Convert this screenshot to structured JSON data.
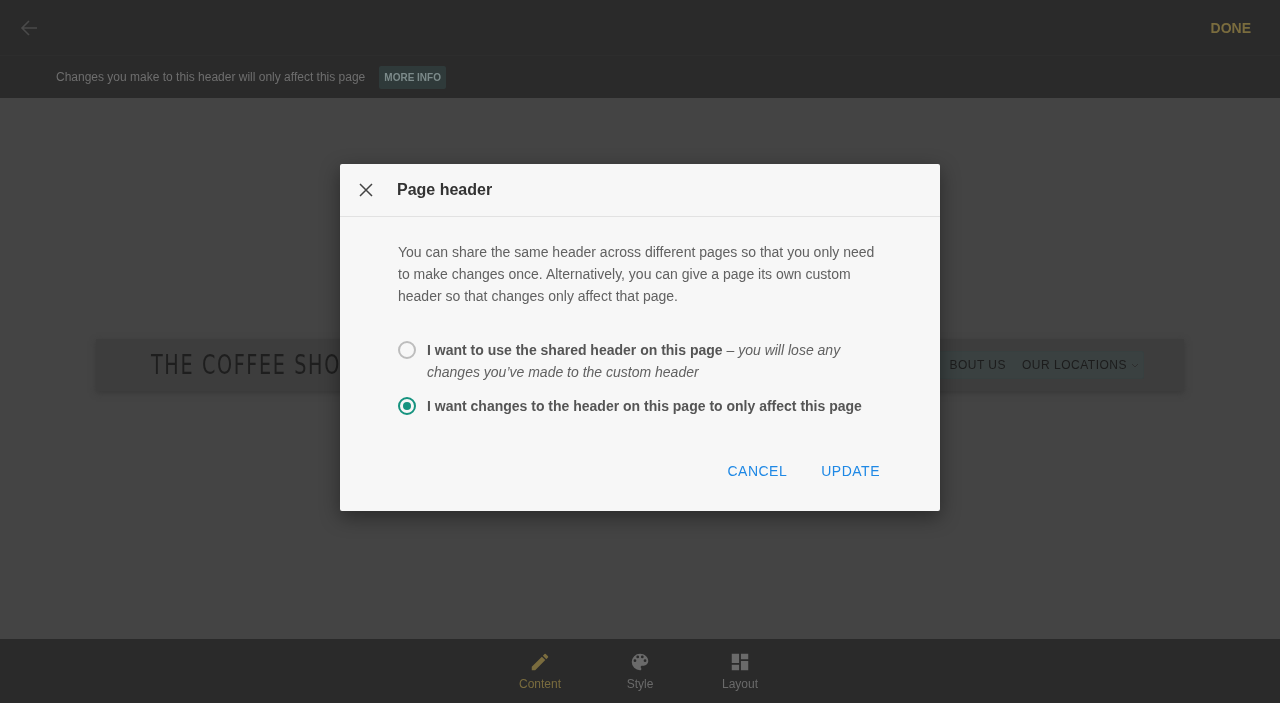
{
  "top_bar": {
    "done": "DONE"
  },
  "notice": {
    "text": "Changes you make to this header will only affect this page",
    "button": "MORE INFO"
  },
  "site_header": {
    "logo": "THE COFFEE SHO",
    "nav": [
      "BOUT US",
      "OUR LOCATIONS"
    ]
  },
  "dialog": {
    "title": "Page header",
    "body": "You can share the same header across different pages so that you only need to make changes once. Alternatively, you can give a page its own custom header so that changes only affect that page.",
    "options": [
      {
        "label": "**I want to use the shared header on this page** *– you will lose any changes you’ve made to the custom header*",
        "selected": false
      },
      {
        "label": "**I want changes to the header on this page to only affect this page**",
        "selected": true
      }
    ],
    "buttons": [
      "CANCEL",
      "UPDATE"
    ]
  },
  "bottom_tabs": [
    {
      "label": "Content",
      "kind": "pencil",
      "selected": true
    },
    {
      "label": "Style",
      "kind": "palette",
      "selected": false
    },
    {
      "label": "Layout",
      "kind": "layout",
      "selected": false
    }
  ]
}
